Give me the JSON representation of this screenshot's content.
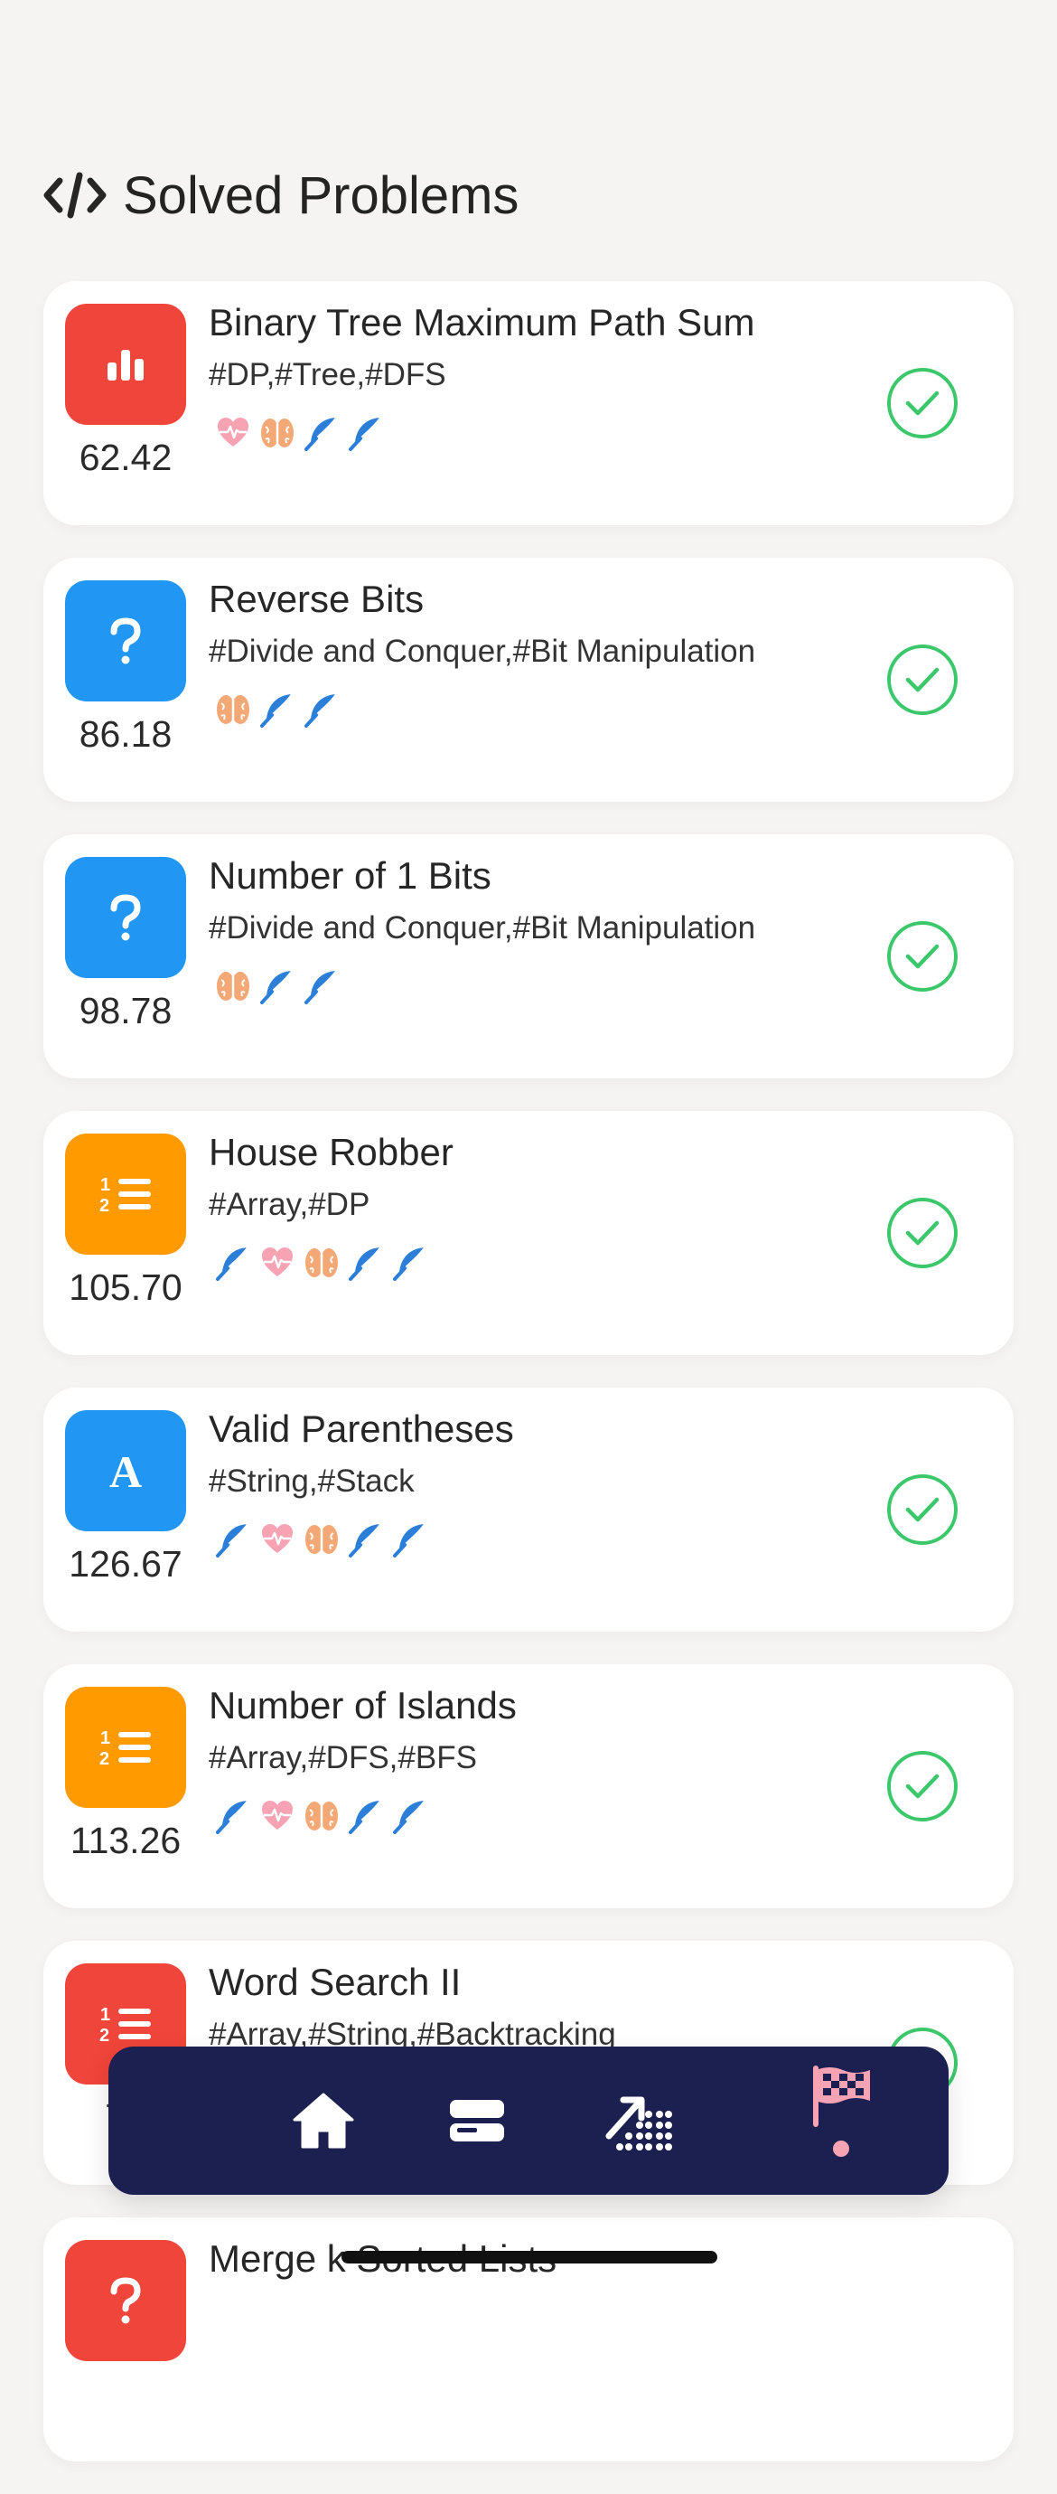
{
  "header": {
    "title": "Solved Problems",
    "icon": "code-icon"
  },
  "colors": {
    "red": "#f0453a",
    "blue": "#2196f3",
    "orange": "#ff9a00",
    "check_green": "#3cc86a",
    "heart": "#f7a3b4",
    "brain": "#f4a876",
    "feather": "#2b7fd8",
    "nav_bg": "#1c2050"
  },
  "problems": [
    {
      "name": "Binary Tree Maximum Path Sum",
      "tags": "#DP,#Tree,#DFS",
      "score": "62.42",
      "badge_icon": "bar-chart-icon",
      "badge_color": "red",
      "icons": [
        "heart",
        "brain",
        "feather",
        "feather"
      ],
      "solved": true
    },
    {
      "name": "Reverse Bits",
      "tags": "#Divide and Conquer,#Bit Manipulation",
      "score": "86.18",
      "badge_icon": "question-icon",
      "badge_color": "blue",
      "icons": [
        "brain",
        "feather",
        "feather"
      ],
      "solved": true
    },
    {
      "name": "Number of 1 Bits",
      "tags": "#Divide and Conquer,#Bit Manipulation",
      "score": "98.78",
      "badge_icon": "question-icon",
      "badge_color": "blue",
      "icons": [
        "brain",
        "feather",
        "feather"
      ],
      "solved": true
    },
    {
      "name": "House Robber",
      "tags": "#Array,#DP",
      "score": "105.70",
      "badge_icon": "numbered-list-icon",
      "badge_color": "orange",
      "icons": [
        "feather",
        "heart",
        "brain",
        "feather",
        "feather"
      ],
      "solved": true
    },
    {
      "name": "Valid Parentheses",
      "tags": "#String,#Stack",
      "score": "126.67",
      "badge_icon": "letter-a-icon",
      "badge_color": "blue",
      "icons": [
        "feather",
        "heart",
        "brain",
        "feather",
        "feather"
      ],
      "solved": true
    },
    {
      "name": "Number of Islands",
      "tags": "#Array,#DFS,#BFS",
      "score": "113.26",
      "badge_icon": "numbered-list-icon",
      "badge_color": "orange",
      "icons": [
        "feather",
        "heart",
        "brain",
        "feather",
        "feather"
      ],
      "solved": true
    },
    {
      "name": "Word Search II",
      "tags": "#Array,#String,#Backtracking",
      "score": "70",
      "badge_icon": "numbered-list-icon",
      "badge_color": "red",
      "icons": [
        "feather",
        "feather"
      ],
      "solved": true
    },
    {
      "name": "Merge k Sorted Lists",
      "tags": "",
      "score": "",
      "badge_icon": "question-icon",
      "badge_color": "red",
      "icons": [],
      "solved": false
    }
  ],
  "nav": {
    "items": [
      {
        "icon": "home-icon"
      },
      {
        "icon": "stack-icon"
      },
      {
        "icon": "trend-dots-icon"
      },
      {
        "icon": "checkered-flag-icon",
        "active": true
      }
    ]
  }
}
